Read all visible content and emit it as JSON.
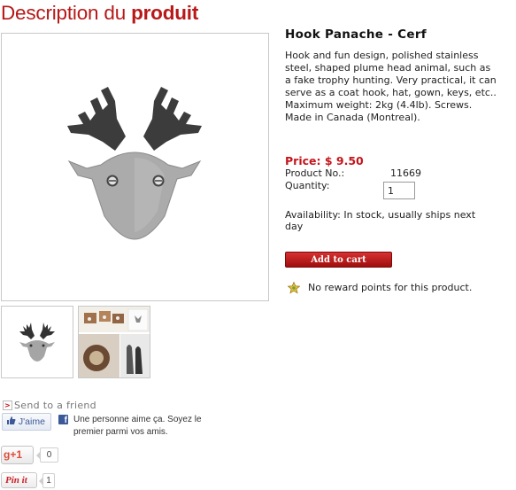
{
  "page": {
    "heading_normal": "Description du ",
    "heading_bold": "produit"
  },
  "product": {
    "title": "Hook Panache - Cerf",
    "description": "Hook and fun design, polished stainless steel, shaped plume head animal, such as a fake trophy hunting. Very practical, it can serve as a coat hook, hat, gown, keys, etc.. Maximum weight: 2kg (4.4lb). Screws. Made in Canada (Montreal).",
    "price": "Price: $ 9.50",
    "product_no_label": "Product No.:",
    "product_no_value": "11669",
    "quantity_label": "Quantity:",
    "quantity_value": "1",
    "availability": "Availability:   In stock, usually ships next day",
    "add_to_cart_label": "Add to cart",
    "reward_text": "No reward points for this product."
  },
  "images": {
    "main_icon": "deer-head-hook-image",
    "thumbnails": [
      "deer-head-hook-thumbnail",
      "hooks-in-use-thumbnail"
    ]
  },
  "social": {
    "send_to_friend": "Send to a friend",
    "fb_like_label": "J'aime",
    "fb_text": "Une personne aime ça. Soyez le premier parmi vos amis.",
    "gplus_label": "+1",
    "gplus_count": "0",
    "pinit_label": "Pin it",
    "pinit_count": "1"
  },
  "colors": {
    "brand_red": "#b81818",
    "price_red": "#c4161c",
    "facebook_blue": "#3b5998"
  }
}
